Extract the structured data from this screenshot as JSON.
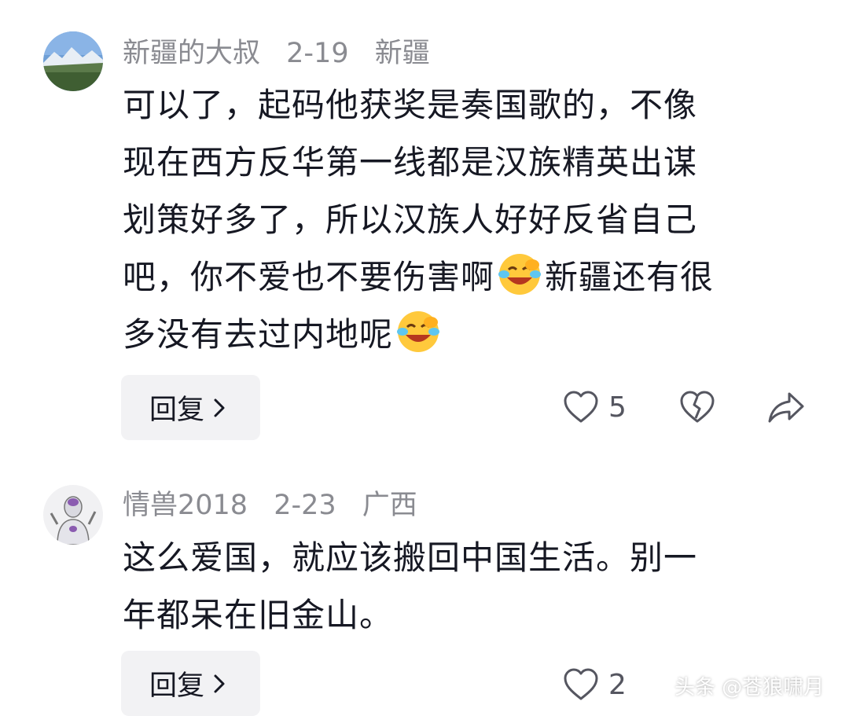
{
  "comments": [
    {
      "username": "新疆的大叔",
      "date": "2-19",
      "location": "新疆",
      "lines": [
        "可以了，起码他获奖是奏国歌的，不像",
        "现在西方反华第一线都是汉族精英出谋",
        "划策好多了，所以汉族人好好反省自己",
        "吧，你不爱也不要伤害啊",
        "新疆还有很",
        "多没有去过内地呢"
      ],
      "emoji_icon": "laughing-cry-emoji",
      "reply_label": "回复",
      "like_count": "5"
    },
    {
      "username": "情兽2018",
      "date": "2-23",
      "location": "广西",
      "lines": [
        "这么爱国，就应该搬回中国生活。别一",
        "年都呆在旧金山。"
      ],
      "reply_label": "回复",
      "like_count": "2"
    }
  ],
  "watermark": "头条 @苍狼啸月",
  "colors": {
    "meta_gray": "#8a8b91",
    "text": "#161823",
    "reply_bg": "#f2f2f4"
  }
}
